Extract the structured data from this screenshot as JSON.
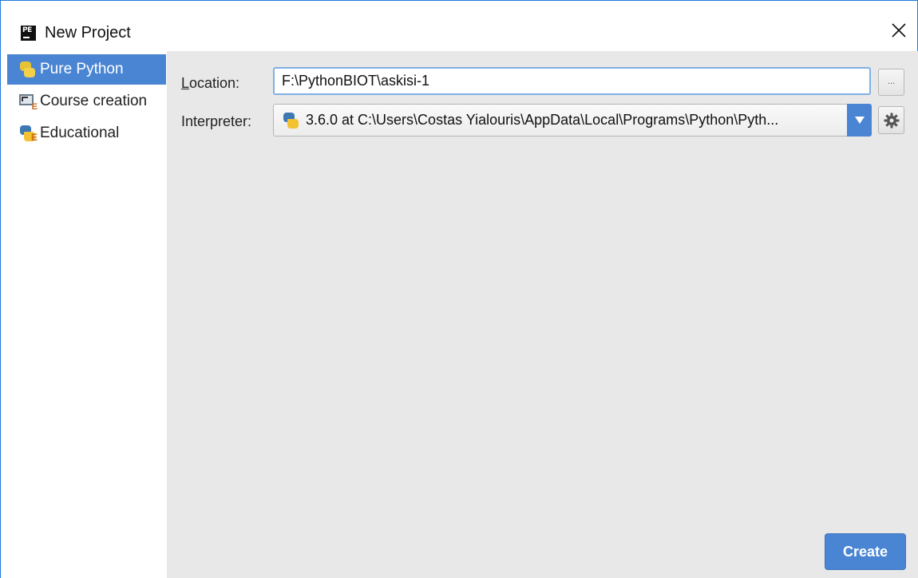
{
  "window": {
    "title": "New Project",
    "logo_text": "PE"
  },
  "sidebar": {
    "items": [
      {
        "label": "Pure Python",
        "icon": "python-icon",
        "selected": true
      },
      {
        "label": "Course creation",
        "icon": "course-creation-icon",
        "selected": false
      },
      {
        "label": "Educational",
        "icon": "educational-icon",
        "selected": false
      }
    ]
  },
  "form": {
    "location_label_u": "L",
    "location_label_rest": "ocation:",
    "location_value": "F:\\PythonBIOT\\askisi-1",
    "browse_label": "...",
    "interpreter_label": "Interpreter:",
    "interpreter_value": "3.6.0 at C:\\Users\\Costas Yialouris\\AppData\\Local\\Programs\\Python\\Pyth..."
  },
  "actions": {
    "create_label": "Create"
  },
  "colors": {
    "accent": "#4a85d3",
    "pane_bg": "#e8e8e8",
    "window_border": "#1e7ad8"
  }
}
